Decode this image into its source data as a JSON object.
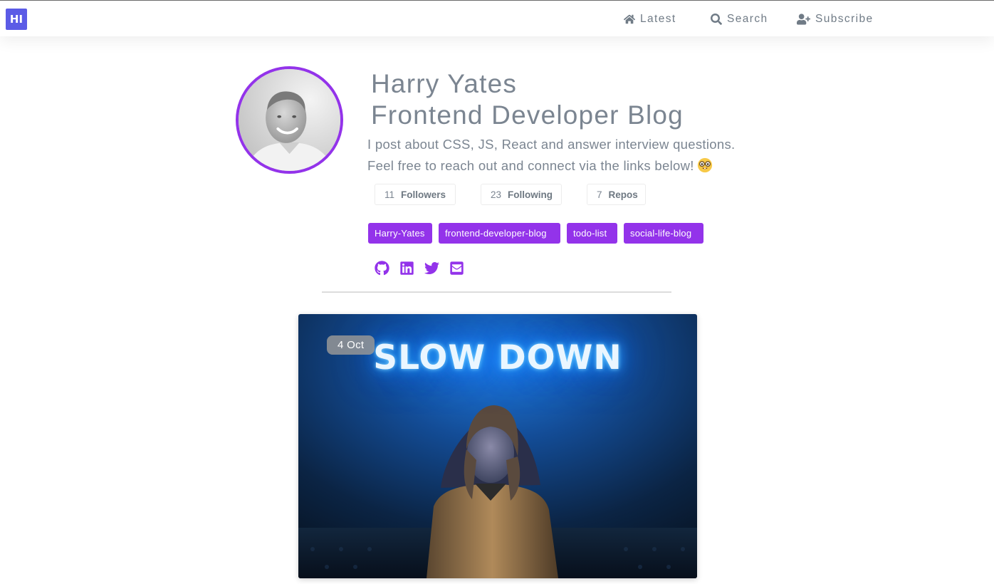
{
  "header": {
    "logo_text": "HI",
    "nav": [
      {
        "label": "Latest",
        "icon": "home-icon"
      },
      {
        "label": "Search",
        "icon": "search-icon"
      },
      {
        "label": "Subscribe",
        "icon": "user-plus-icon"
      }
    ]
  },
  "profile": {
    "name": "Harry Yates",
    "blog_title": "Frontend Developer Blog",
    "bio_line1": "I post about CSS, JS, React and answer interview questions.",
    "bio_line2": "Feel free to reach out and connect via the links below!",
    "bio_emoji": "nerd-face-emoji",
    "stats": [
      {
        "count": "11",
        "label": "Followers"
      },
      {
        "count": "23",
        "label": "Following"
      },
      {
        "count": "7",
        "label": "Repos"
      }
    ],
    "tags": [
      "Harry-Yates",
      "frontend-developer-blog",
      "todo-list",
      "social-life-blog"
    ],
    "social_links": [
      "github-icon",
      "linkedin-icon",
      "twitter-icon",
      "email-icon"
    ]
  },
  "post": {
    "date": "4 Oct",
    "image_text": "SLOW DOWN"
  },
  "colors": {
    "accent": "#9333ea",
    "logo_bg": "#5b5be6",
    "text": "#7b8591"
  }
}
